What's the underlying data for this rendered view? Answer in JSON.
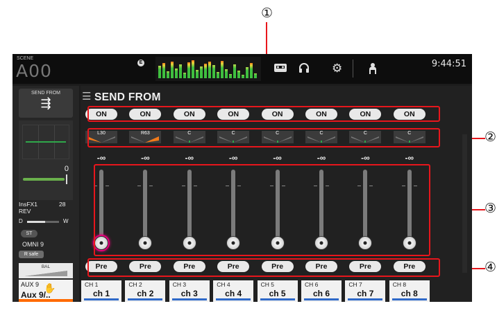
{
  "callouts": [
    "①",
    "②",
    "③",
    "④"
  ],
  "topbar": {
    "scene_label": "SCENE",
    "scene_number": "A00",
    "badge": "E",
    "time": "9:44:51",
    "icons": [
      "recorder-icon",
      "headphones-icon",
      "settings-gear-icon",
      "user-icon"
    ]
  },
  "left_strip": {
    "send_from_label": "SEND FROM",
    "send_from_icon": "⇶",
    "gain_value": "0",
    "insfx_name": "InsFX1",
    "insfx_effect": "REV",
    "insfx_num": "28",
    "dry_label": "D",
    "wet_label": "W",
    "st_label": "ST",
    "omni_label": "OMNI 9",
    "rsafe_label": "R safe",
    "bal_label": "BAL",
    "aux_small": "AUX 9",
    "aux_big": "Aux 9/..",
    "aux_color": "#ff6a00"
  },
  "main": {
    "title": "SEND FROM",
    "on_label": "ON",
    "pre_label": "Pre",
    "channels": [
      {
        "ch": "CH 1",
        "name": "ch 1",
        "pan": "L30",
        "level": "-∞"
      },
      {
        "ch": "CH 2",
        "name": "ch 2",
        "pan": "R63",
        "level": "-∞"
      },
      {
        "ch": "CH 3",
        "name": "ch 3",
        "pan": "C",
        "level": "-∞"
      },
      {
        "ch": "CH 4",
        "name": "ch 4",
        "pan": "C",
        "level": "-∞"
      },
      {
        "ch": "CH 5",
        "name": "ch 5",
        "pan": "C",
        "level": "-∞"
      },
      {
        "ch": "CH 6",
        "name": "ch 6",
        "pan": "C",
        "level": "-∞"
      },
      {
        "ch": "CH 7",
        "name": "ch 7",
        "pan": "C",
        "level": "-∞"
      },
      {
        "ch": "CH 8",
        "name": "ch 8",
        "pan": "C",
        "level": "-∞"
      }
    ],
    "accent": "#e8161c",
    "pan_color": "#f07a1a",
    "channel_color": "#2f69c8",
    "selected_color": "#e5007a"
  }
}
